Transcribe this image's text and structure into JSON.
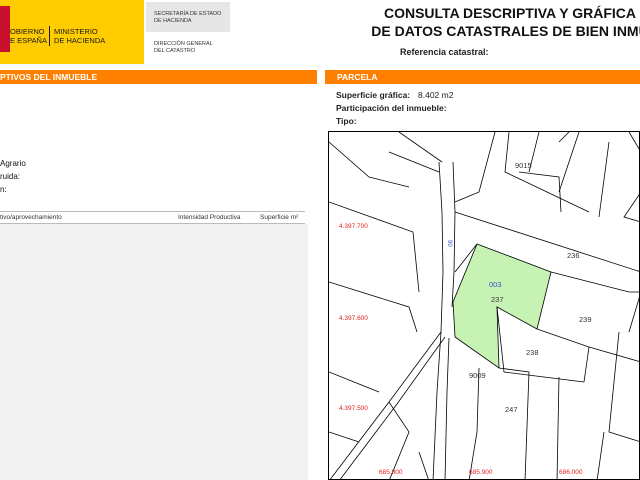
{
  "header": {
    "gov_label": "OBIERNO\nE ESPAÑA",
    "ministry_label": "MINISTERIO\nDE HACIENDA",
    "secretariat_label": "SECRETARÍA DE ESTADO\nDE HACIENDA",
    "directorate_label": "DIRECCIÓN GENERAL\nDEL CATASTRO",
    "title": "CONSULTA DESCRIPTIVA Y GRÁFICA\nDE DATOS CATASTRALES DE BIEN INMU",
    "cadastral_ref_label": "Referencia catastral:"
  },
  "left_panel": {
    "section_title": "PTIVOS DEL INMUEBLE",
    "use_value": "Agrario",
    "built_label": "ruida:",
    "row3_label": "n:",
    "table": {
      "col_crop": "tivo/aprovechamiento",
      "col_intensity": "Intensidad Productiva",
      "col_area": "Superficie m²"
    }
  },
  "right_panel": {
    "section_title": "PARCELA",
    "graphic_area_label": "Superficie gráfica:",
    "graphic_area_value": "8.402 m2",
    "participation_label": "Participación del inmueble:",
    "type_label": "Tipo:"
  },
  "map": {
    "highlight_color": "#c6f2b4",
    "road_code": "90",
    "plot_labels": [
      "9015",
      "236",
      "003",
      "237",
      "239",
      "238",
      "9009",
      "247"
    ],
    "coordinates_y": [
      "4.397.700",
      "4.397.600",
      "4.397.500"
    ],
    "coordinates_x": [
      "685.800",
      "685.900",
      "686.000"
    ]
  }
}
